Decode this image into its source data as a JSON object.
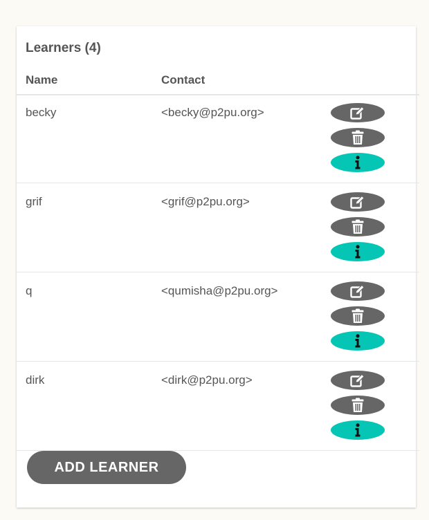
{
  "learners": {
    "title": "Learners (4)",
    "columns": {
      "name": "Name",
      "contact": "Contact"
    },
    "rows": [
      {
        "name": "becky",
        "contact": "<becky@p2pu.org>"
      },
      {
        "name": "grif",
        "contact": "<grif@p2pu.org>"
      },
      {
        "name": "q",
        "contact": "<qumisha@p2pu.org>"
      },
      {
        "name": "dirk",
        "contact": "<dirk@p2pu.org>"
      }
    ],
    "actions": [
      "edit-icon",
      "trash-icon",
      "info-icon"
    ],
    "add_button_label": "ADD LEARNER"
  },
  "colors": {
    "page_background": "#fbfaf5",
    "text": "#555555",
    "button_gray": "#666666",
    "info_teal": "#05c6b4",
    "divider": "#e6e6e6"
  }
}
